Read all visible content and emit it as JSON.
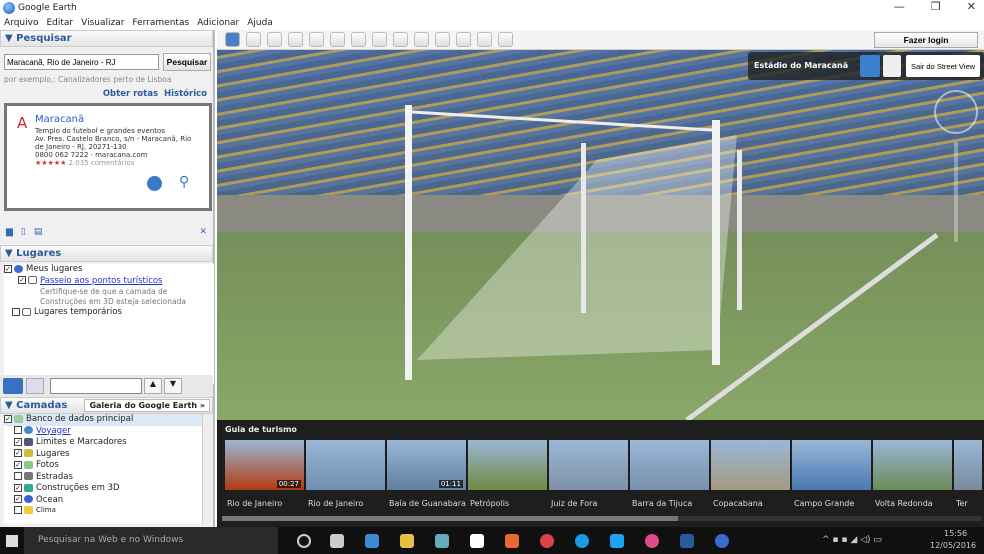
{
  "window": {
    "title": "Google Earth",
    "controls": [
      "—",
      "❐",
      "✕"
    ]
  },
  "menu": [
    "Arquivo",
    "Editar",
    "Visualizar",
    "Ferramentas",
    "Adicionar",
    "Ajuda"
  ],
  "search": {
    "header": "▼ Pesquisar",
    "value": "Maracanã, Rio de Janeiro - RJ",
    "button": "Pesquisar",
    "hint": "por exemplo,: Canalizadores perto de Lisboa",
    "directions": "Obter rotas",
    "history": "Histórico"
  },
  "result": {
    "marker": "A",
    "name": "Maracanã",
    "desc": "Templo do futebol e grandes eventos",
    "address": "Av. Pres. Castelo Branco, s/n - Maracanã, Rio de Janeiro - RJ, 20271-130",
    "phone": "0800 062 7222 · maracana.com",
    "stars": "★★★★★",
    "reviews": "2.035 comentários"
  },
  "places": {
    "header": "▼ Lugares",
    "my_places": "Meus lugares",
    "tour": "Passeio aos pontos turísticos",
    "tour_note1": "Certifique-se de que a camada de",
    "tour_note2": "Construções em 3D esteja selecionada",
    "temp": "Lugares temporários"
  },
  "layers": {
    "header": "▼ Camadas",
    "gallery": "Galeria do Google Earth »",
    "items": [
      {
        "label": "Banco de dados principal",
        "checked": true
      },
      {
        "label": "Voyager",
        "checked": false
      },
      {
        "label": "Limites e Marcadores",
        "checked": true
      },
      {
        "label": "Lugares",
        "checked": true
      },
      {
        "label": "Fotos",
        "checked": true
      },
      {
        "label": "Estradas",
        "checked": false
      },
      {
        "label": "Construções em 3D",
        "checked": true
      },
      {
        "label": "Ocean",
        "checked": true
      },
      {
        "label": "Clima",
        "checked": false
      }
    ]
  },
  "toolbar": {
    "login": "Fazer login"
  },
  "streetview": {
    "place": "Estádio do Maracanã",
    "exit": "Sair do Street View"
  },
  "tour_guide": {
    "header": "Guia de turismo",
    "items": [
      {
        "label": "Rio de Janeiro",
        "duration": "00:27",
        "color": "#b33a10"
      },
      {
        "label": "Rio de Janeiro",
        "duration": "",
        "color": "#6f8fb0"
      },
      {
        "label": "Baía de Guanabara",
        "duration": "01:11",
        "color": "#5f7f9c"
      },
      {
        "label": "Petrópolis",
        "duration": "",
        "color": "#6f8a40"
      },
      {
        "label": "Juiz de Fora",
        "duration": "",
        "color": "#8090a8"
      },
      {
        "label": "Barra da Tijuca",
        "duration": "",
        "color": "#7890ac"
      },
      {
        "label": "Copacabana",
        "duration": "",
        "color": "#a59a80"
      },
      {
        "label": "Campo Grande",
        "duration": "",
        "color": "#4a78b0"
      },
      {
        "label": "Volta Redonda",
        "duration": "",
        "color": "#6a8a5a"
      },
      {
        "label": "Ter",
        "duration": "",
        "color": "#7a8a9a"
      }
    ]
  },
  "taskbar": {
    "search": "Pesquisar na Web e no Windows",
    "time": "15:56",
    "date": "12/05/2016"
  }
}
